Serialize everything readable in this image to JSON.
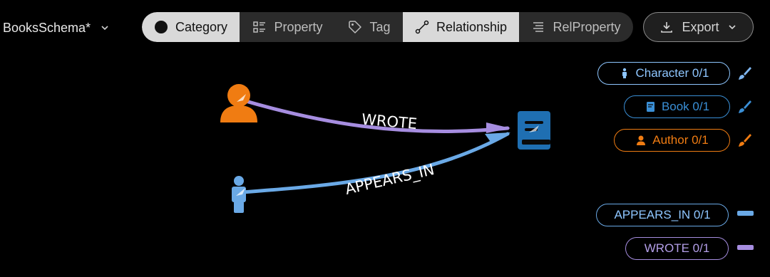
{
  "header": {
    "schema_name": "BooksSchema*",
    "modes": [
      {
        "label": "Category",
        "active": true
      },
      {
        "label": "Property",
        "active": false
      },
      {
        "label": "Tag",
        "active": false
      },
      {
        "label": "Relationship",
        "active": true
      },
      {
        "label": "RelProperty",
        "active": false
      }
    ],
    "export_label": "Export"
  },
  "graph": {
    "nodes": [
      {
        "name": "Author",
        "icon": "person-icon",
        "color": "#f07c12"
      },
      {
        "name": "Character",
        "icon": "standing-person-icon",
        "color": "#6aa9e6"
      },
      {
        "name": "Book",
        "icon": "book-icon",
        "color": "#1f6fb2"
      }
    ],
    "edges": [
      {
        "label": "WROTE",
        "from": "Author",
        "to": "Book",
        "color": "#a68de0"
      },
      {
        "label": "APPEARS_IN",
        "from": "Character",
        "to": "Book",
        "color": "#6aa9e6"
      }
    ]
  },
  "legend": {
    "categories": [
      {
        "label": "Character 0/1",
        "color": "#8ec6ff",
        "icon": "standing-person-icon",
        "brush_color": "#7fb6f0"
      },
      {
        "label": "Book 0/1",
        "color": "#3a8fd6",
        "icon": "book-icon",
        "brush_color": "#3a8fd6"
      },
      {
        "label": "Author 0/1",
        "color": "#f07c12",
        "icon": "person-icon",
        "brush_color": "#f07c12"
      }
    ],
    "relationships": [
      {
        "label": "APPEARS_IN 0/1",
        "color": "#6aa9e6"
      },
      {
        "label": "WROTE 0/1",
        "color": "#a68de0"
      }
    ]
  }
}
